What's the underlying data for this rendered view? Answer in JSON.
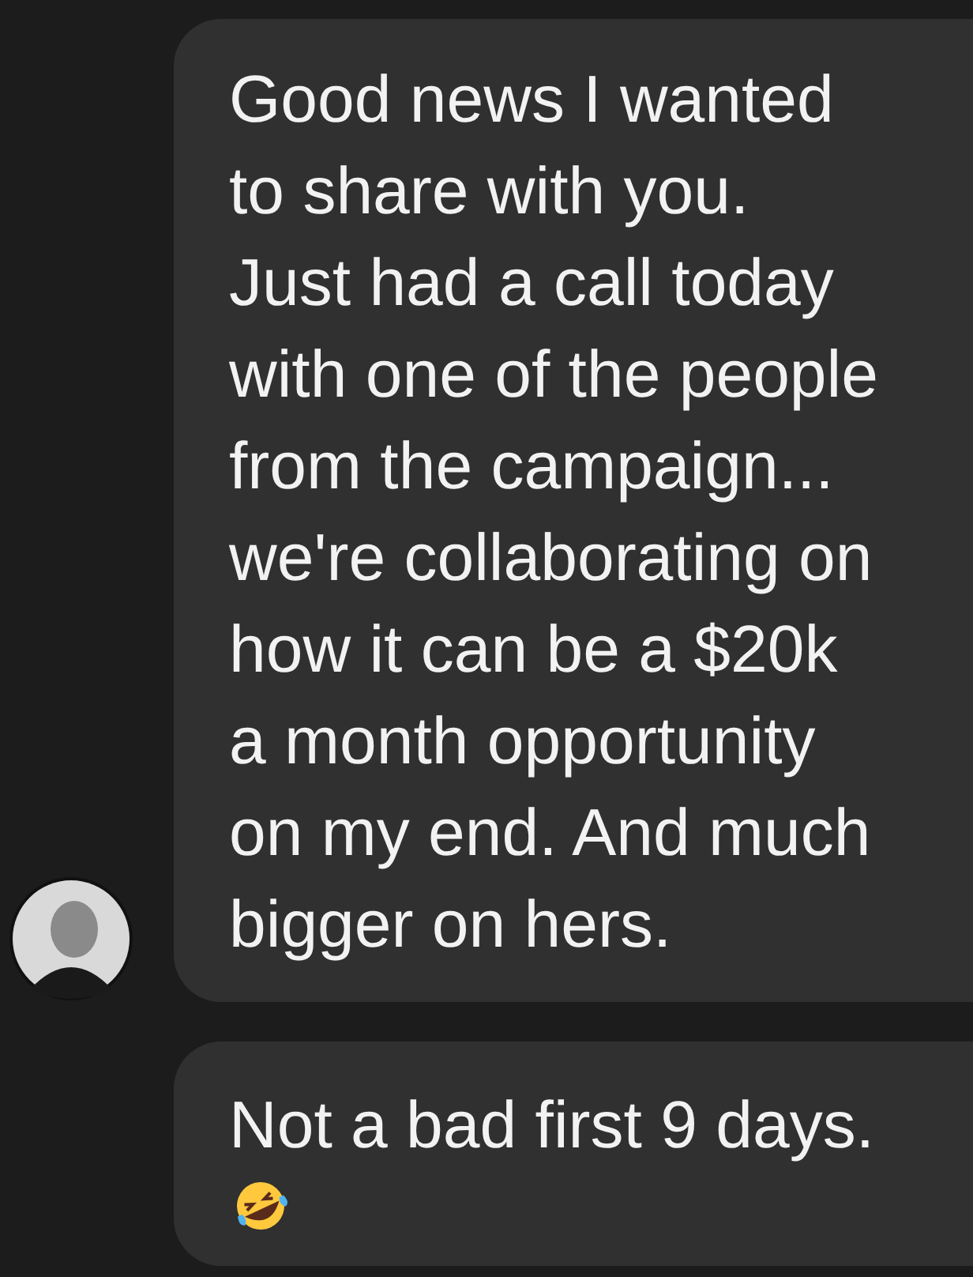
{
  "messages": [
    {
      "lines": [
        "Good news I wanted",
        "to share with you.",
        "Just had a call today",
        "with one of the people",
        "from the campaign...",
        "we're collaborating on",
        "how it can be a $20k",
        "a month opportunity",
        "on my end. And much",
        "bigger on hers."
      ],
      "avatar": true,
      "emoji": false
    },
    {
      "lines": [
        "Not a bad first 9 days."
      ],
      "avatar": false,
      "emoji": true
    }
  ]
}
